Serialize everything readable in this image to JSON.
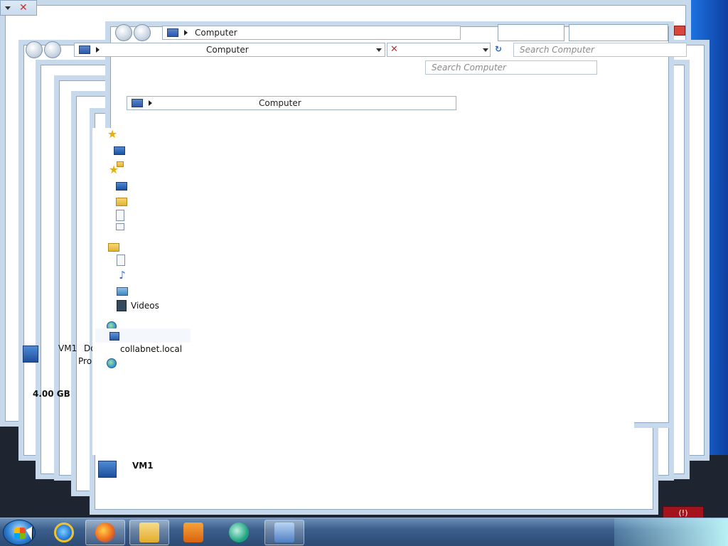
{
  "address_bars": [
    {
      "label": "Computer"
    },
    {
      "label": "Computer"
    },
    {
      "label": "Computer"
    }
  ],
  "search_boxes": [
    {
      "placeholder": "Search Computer"
    },
    {
      "placeholder": "Search Computer"
    }
  ],
  "navigation": {
    "items": [
      {
        "icon": "star-icon",
        "label": ""
      },
      {
        "icon": "monitor-icon",
        "label": ""
      },
      {
        "icon": "folder-icon",
        "label": ""
      },
      {
        "icon": "star-icon",
        "label": ""
      },
      {
        "icon": "monitor-icon",
        "label": ""
      },
      {
        "icon": "downloads-folder-icon",
        "label": ""
      },
      {
        "icon": "document-icon",
        "label": ""
      },
      {
        "icon": "document-icon",
        "label": ""
      },
      {
        "icon": "library-folder-icon",
        "label": ""
      },
      {
        "icon": "document-icon",
        "label": ""
      },
      {
        "icon": "music-icon",
        "label": ""
      },
      {
        "icon": "picture-icon",
        "label": ""
      },
      {
        "icon": "film-icon",
        "label": "Videos"
      }
    ]
  },
  "computer_info": {
    "name_partial": "VM1",
    "domain_label": "Domain:",
    "domain_value": "collabnet.local",
    "processor_label": "Pro",
    "disk_size": "4.00 GB"
  },
  "bottom_computer": {
    "name": "VM1"
  },
  "tray": {
    "indicator": "(!)"
  },
  "colors": {
    "desktop_blue": "#1547a6",
    "taskbar": "#3c5f8c",
    "window_border": "#c7d9ea"
  }
}
